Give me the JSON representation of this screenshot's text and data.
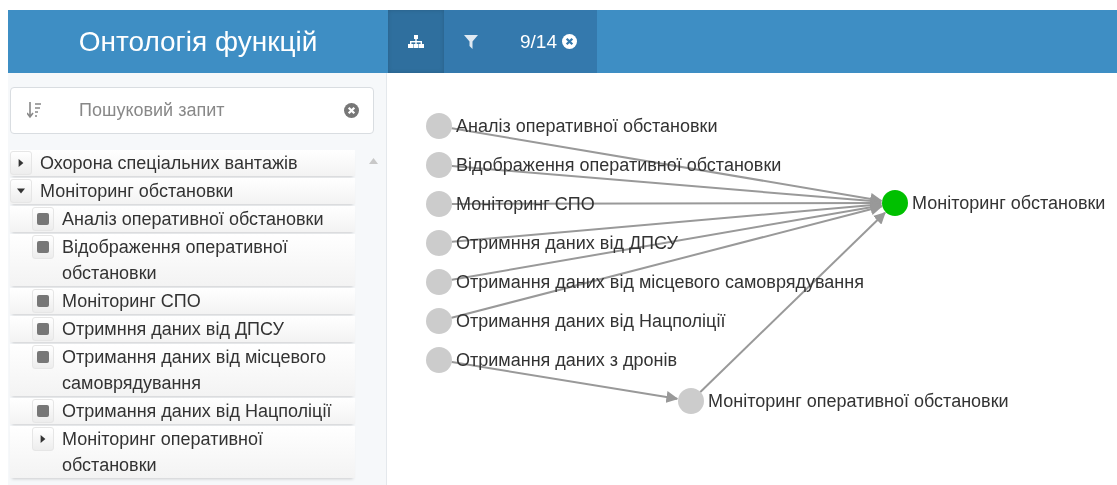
{
  "header": {
    "title": "Онтологія функцій"
  },
  "tabs": [
    {
      "kind": "hierarchy",
      "selected": true
    },
    {
      "kind": "filter",
      "selected": false
    },
    {
      "kind": "counter",
      "label": "9/14",
      "selected": false
    }
  ],
  "search": {
    "placeholder": "Пошуковий запит"
  },
  "tree": {
    "items": [
      {
        "kind": "branch",
        "label": "Охорона спеціальних вантажів",
        "expanded": false
      },
      {
        "kind": "branch",
        "label": "Моніторинг обстановки",
        "expanded": true,
        "children": [
          {
            "kind": "leaf",
            "label": "Аналіз оперативної обстановки"
          },
          {
            "kind": "leaf",
            "label": "Відображення оперативної обстановки"
          },
          {
            "kind": "leaf",
            "label": "Моніторинг СПО"
          },
          {
            "kind": "leaf",
            "label": "Отримння даних від ДПСУ"
          },
          {
            "kind": "leaf",
            "label": "Отримання даних від місцевого самоврядування"
          },
          {
            "kind": "leaf",
            "label": "Отримання даних від Нацполіції"
          },
          {
            "kind": "branch",
            "label": "Моніторинг оперативної обстановки",
            "expanded": false
          }
        ]
      }
    ]
  },
  "graph": {
    "nodes": [
      {
        "kind": "source",
        "via_relay": false,
        "label": "Аналіз оперативної обстановки",
        "color": "#cccccc"
      },
      {
        "kind": "source",
        "via_relay": false,
        "label": "Відображення оперативної обстановки",
        "color": "#cccccc"
      },
      {
        "kind": "source",
        "via_relay": false,
        "label": "Моніторинг СПО",
        "color": "#cccccc"
      },
      {
        "kind": "source",
        "via_relay": false,
        "label": "Отримння даних від ДПСУ",
        "color": "#cccccc"
      },
      {
        "kind": "source",
        "via_relay": false,
        "label": "Отримання даних від місцевого самоврядування",
        "color": "#cccccc"
      },
      {
        "kind": "source",
        "via_relay": false,
        "label": "Отримання даних від Нацполіції",
        "color": "#cccccc"
      },
      {
        "kind": "source",
        "via_relay": true,
        "label": "Отримання даних з дронів",
        "color": "#cccccc"
      },
      {
        "kind": "target",
        "label": "Моніторинг обстановки",
        "color": "#00c000"
      },
      {
        "kind": "relay",
        "label": "Моніторинг оперативної обстановки",
        "color": "#cccccc"
      }
    ]
  }
}
